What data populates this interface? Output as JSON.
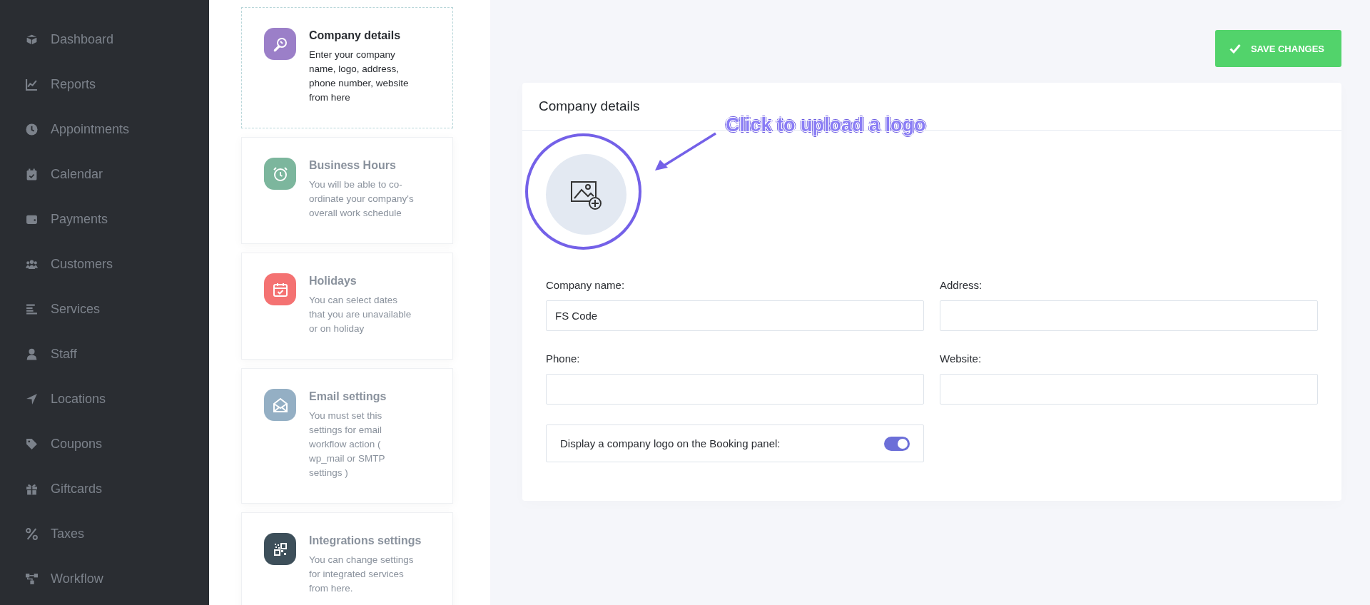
{
  "sidebar": {
    "items": [
      {
        "label": "Dashboard"
      },
      {
        "label": "Reports"
      },
      {
        "label": "Appointments"
      },
      {
        "label": "Calendar"
      },
      {
        "label": "Payments"
      },
      {
        "label": "Customers"
      },
      {
        "label": "Services"
      },
      {
        "label": "Staff"
      },
      {
        "label": "Locations"
      },
      {
        "label": "Coupons"
      },
      {
        "label": "Giftcards"
      },
      {
        "label": "Taxes"
      },
      {
        "label": "Workflow"
      }
    ]
  },
  "settings_menu": [
    {
      "title": "Company details",
      "description": "Enter your company name, logo, address, phone number, website from here",
      "color": "#9b7fc8",
      "selected": true
    },
    {
      "title": "Business Hours",
      "description": "You will be able to co-ordinate your company's overall work schedule",
      "color": "#7cb69d",
      "selected": false
    },
    {
      "title": "Holidays",
      "description": "You can select dates that you are unavailable or on holiday",
      "color": "#f47272",
      "selected": false
    },
    {
      "title": "Email settings",
      "description": "You must set this settings for email workflow action ( wp_mail or SMTP settings )",
      "color": "#94afc4",
      "selected": false
    },
    {
      "title": "Integrations settings",
      "description": "You can change settings for integrated services from here.",
      "color": "#3d4f5a",
      "selected": false
    }
  ],
  "save_button": "SAVE CHANGES",
  "panel": {
    "title": "Company details",
    "annotation": "Click to upload a logo",
    "fields": [
      {
        "label": "Company name:",
        "value": "FS Code"
      },
      {
        "label": "Address:"
      },
      {
        "label": "Phone:"
      },
      {
        "label": "Website:"
      }
    ],
    "toggle": {
      "label": "Display a company logo on the Booking panel:",
      "on": true
    }
  }
}
